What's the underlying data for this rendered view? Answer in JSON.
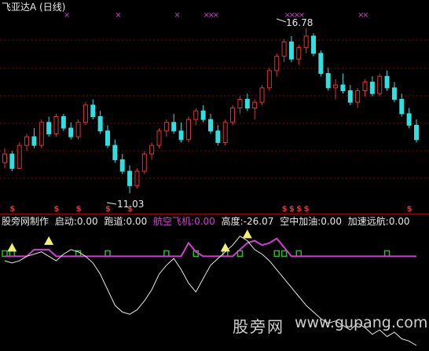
{
  "header": {
    "title": "飞亚达A (日线)"
  },
  "annotations": {
    "high": "16.78",
    "low": "11.03",
    "marker_x": "×",
    "marker_s": "$"
  },
  "indicator": {
    "name": "股旁网制作",
    "items": [
      {
        "label": "启动:0.00",
        "color": "#e8e8e8"
      },
      {
        "label": "跑道:0.00",
        "color": "#e8e8e8"
      },
      {
        "label": "航空飞机:0.00",
        "color": "#d43bd4"
      },
      {
        "label": "高度:-26.07",
        "color": "#e8e8e8"
      },
      {
        "label": "空中加油:0.00",
        "color": "#e8e8e8"
      },
      {
        "label": "加速远航:0.00",
        "color": "#e8e8e8"
      }
    ]
  },
  "watermark": {
    "cn": "股旁网",
    "url": "www.gupang.com"
  },
  "colors": {
    "up": "#e83030",
    "down": "#30e0e0",
    "indicator_line": "#e8e8e0",
    "aircraft": "#d43bd4",
    "triangle": "#f0f070",
    "block": "#20c020",
    "grid": "#8a0000"
  },
  "chart_data": {
    "type": "candlestick",
    "price_range": [
      10.6,
      17.1
    ],
    "candles": [
      [
        12.1,
        12.6,
        11.9,
        12.4
      ],
      [
        12.4,
        12.5,
        11.8,
        11.9
      ],
      [
        11.9,
        12.8,
        11.9,
        12.7
      ],
      [
        12.7,
        13.1,
        12.5,
        13.0
      ],
      [
        13.0,
        13.3,
        12.6,
        12.7
      ],
      [
        12.7,
        13.6,
        12.6,
        13.5
      ],
      [
        13.5,
        13.7,
        13.0,
        13.1
      ],
      [
        13.1,
        13.8,
        13.0,
        13.7
      ],
      [
        13.7,
        13.8,
        13.2,
        13.3
      ],
      [
        13.3,
        13.5,
        12.9,
        13.0
      ],
      [
        13.0,
        13.6,
        12.9,
        13.5
      ],
      [
        13.5,
        14.2,
        13.4,
        14.1
      ],
      [
        14.1,
        14.3,
        13.6,
        13.7
      ],
      [
        13.7,
        13.9,
        13.1,
        13.2
      ],
      [
        13.2,
        13.4,
        12.6,
        12.7
      ],
      [
        12.7,
        12.9,
        12.1,
        12.2
      ],
      [
        12.2,
        12.4,
        11.7,
        11.8
      ],
      [
        11.8,
        12.0,
        11.03,
        11.3
      ],
      [
        11.3,
        11.9,
        11.2,
        11.8
      ],
      [
        11.8,
        12.5,
        11.7,
        12.4
      ],
      [
        12.4,
        12.8,
        12.2,
        12.7
      ],
      [
        12.7,
        13.3,
        12.6,
        13.2
      ],
      [
        13.2,
        13.6,
        13.0,
        13.5
      ],
      [
        13.5,
        13.8,
        13.1,
        13.2
      ],
      [
        13.2,
        13.5,
        12.8,
        12.9
      ],
      [
        12.9,
        13.7,
        12.8,
        13.6
      ],
      [
        13.6,
        14.0,
        13.4,
        13.9
      ],
      [
        13.9,
        14.1,
        13.5,
        13.6
      ],
      [
        13.6,
        13.8,
        13.1,
        13.2
      ],
      [
        13.2,
        13.4,
        12.7,
        12.8
      ],
      [
        12.8,
        13.6,
        12.7,
        13.5
      ],
      [
        13.5,
        14.1,
        13.4,
        14.0
      ],
      [
        14.0,
        14.4,
        13.8,
        14.3
      ],
      [
        14.3,
        14.5,
        13.9,
        14.0
      ],
      [
        14.0,
        14.3,
        13.6,
        14.2
      ],
      [
        14.2,
        14.8,
        14.1,
        14.7
      ],
      [
        14.7,
        15.4,
        14.6,
        15.3
      ],
      [
        15.3,
        15.9,
        15.1,
        15.8
      ],
      [
        15.8,
        16.4,
        15.6,
        16.3
      ],
      [
        16.3,
        16.5,
        15.6,
        15.7
      ],
      [
        15.7,
        16.2,
        15.5,
        16.1
      ],
      [
        16.1,
        16.78,
        15.9,
        16.5
      ],
      [
        16.5,
        16.6,
        15.8,
        15.9
      ],
      [
        15.9,
        16.0,
        15.1,
        15.2
      ],
      [
        15.2,
        15.4,
        14.6,
        14.7
      ],
      [
        14.7,
        15.0,
        14.3,
        14.8
      ],
      [
        14.8,
        15.2,
        14.5,
        14.6
      ],
      [
        14.6,
        14.8,
        14.1,
        14.2
      ],
      [
        14.2,
        14.7,
        14.0,
        14.6
      ],
      [
        14.6,
        15.0,
        14.4,
        14.9
      ],
      [
        14.9,
        15.1,
        14.4,
        14.5
      ],
      [
        14.5,
        15.2,
        14.4,
        15.1
      ],
      [
        15.1,
        15.3,
        14.6,
        14.7
      ],
      [
        14.7,
        14.9,
        14.2,
        14.3
      ],
      [
        14.3,
        14.5,
        13.7,
        13.8
      ],
      [
        13.8,
        14.0,
        13.3,
        13.4
      ],
      [
        13.4,
        13.6,
        12.8,
        12.9
      ]
    ],
    "top_markers_x": [
      8,
      15,
      23,
      27,
      38,
      48
    ],
    "top_markers_count": [
      1,
      1,
      1,
      3,
      4,
      2
    ],
    "indicator_range": [
      -40,
      10
    ],
    "indicator_line": [
      -2,
      -3,
      -2,
      0,
      1,
      2,
      0,
      -2,
      1,
      3,
      2,
      0,
      -3,
      -8,
      -15,
      -22,
      -25,
      -26,
      -24,
      -20,
      -15,
      -8,
      -4,
      -1,
      -6,
      -12,
      -16,
      -10,
      -4,
      -1,
      2,
      5,
      9,
      7,
      3,
      1,
      -2,
      -6,
      -10,
      -14,
      -18,
      -22,
      -25,
      -28,
      -30,
      -29,
      -31,
      -33,
      -30,
      -32,
      -35,
      -33,
      -36,
      -34,
      -37,
      -38,
      -40
    ],
    "aircraft_line": [
      0,
      0,
      0,
      0,
      3,
      3,
      3,
      0,
      0,
      0,
      0,
      0,
      0,
      0,
      0,
      0,
      0,
      0,
      0,
      0,
      0,
      0,
      0,
      0,
      0,
      6,
      2,
      0,
      0,
      0,
      0,
      0,
      3,
      6,
      7,
      5,
      6,
      8,
      4,
      0,
      0,
      0,
      0,
      0,
      0,
      0,
      0,
      0,
      0,
      0,
      0,
      0,
      0,
      0,
      0,
      0,
      0
    ],
    "triangles_at": [
      1,
      6,
      30,
      33
    ],
    "blocks_at": [
      0,
      1,
      10,
      14,
      22,
      26,
      30,
      32,
      37,
      38,
      40,
      52
    ]
  }
}
